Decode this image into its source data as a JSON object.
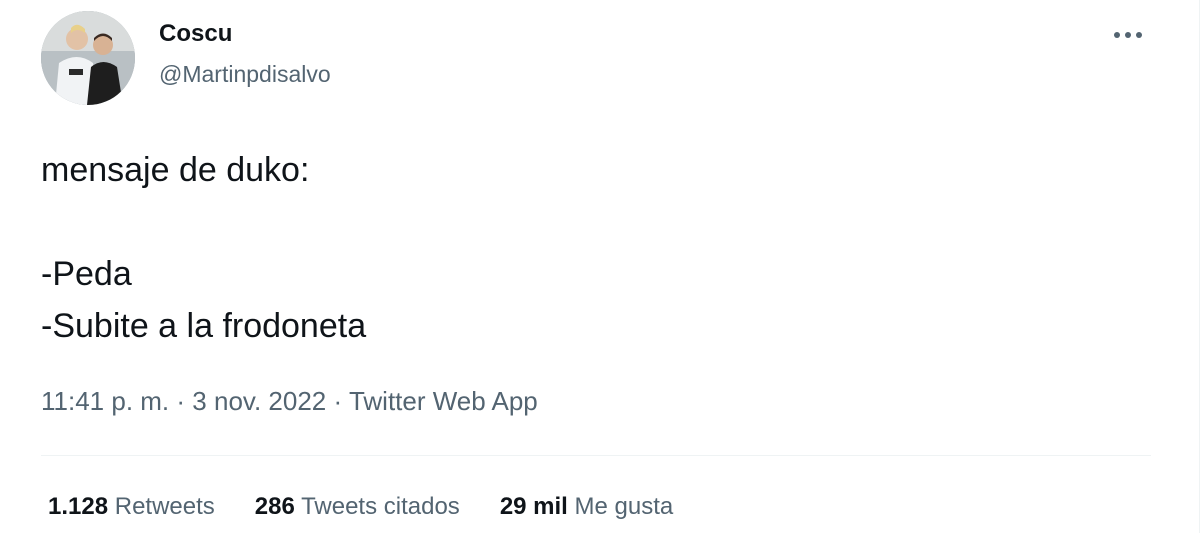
{
  "author": {
    "display_name": "Coscu",
    "handle": "@Martinpdisalvo",
    "avatar_icon": "avatar-photo"
  },
  "more_icon": "ellipsis-icon",
  "tweet": {
    "lines": [
      "mensaje de duko:",
      "",
      "-Peda",
      "-Subite a la frodoneta"
    ]
  },
  "meta": {
    "time": "11:41 p. m.",
    "separator": "·",
    "date": "3 nov. 2022",
    "source": "Twitter Web App"
  },
  "stats": {
    "retweets": {
      "count": "1.128",
      "label": "Retweets"
    },
    "quotes": {
      "count": "286",
      "label": "Tweets citados"
    },
    "likes": {
      "count": "29 mil",
      "label": "Me gusta"
    }
  },
  "colors": {
    "text_primary": "#0f1419",
    "text_secondary": "#536471",
    "divider": "#eff3f4"
  }
}
